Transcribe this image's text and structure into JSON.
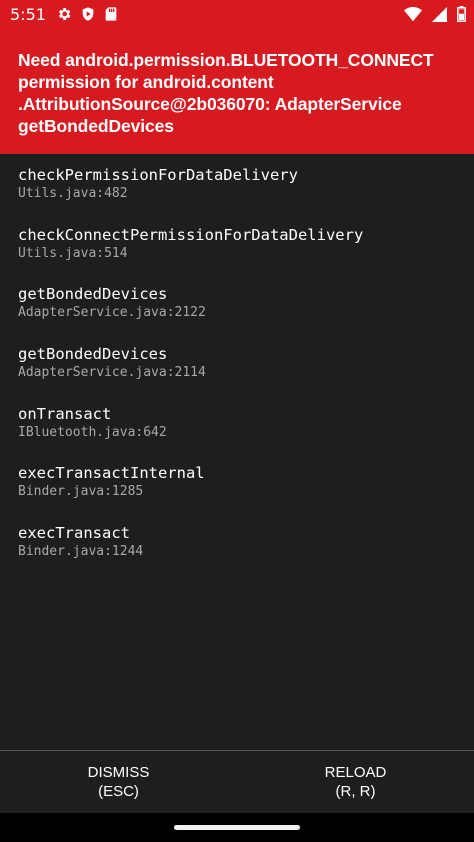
{
  "status_bar": {
    "time": "5:51",
    "left_icons": [
      "gear-icon",
      "play-protect-icon",
      "sd-card-icon"
    ],
    "right_icons": [
      "wifi-icon",
      "cellular-signal-icon",
      "battery-icon"
    ]
  },
  "error": {
    "title": "Need android.permission.BLUETOOTH_CONNECT permission for android.content .AttributionSource@2b036070: AdapterService getBondedDevices"
  },
  "stack_frames": [
    {
      "method": "checkPermissionForDataDelivery",
      "location": "Utils.java:482"
    },
    {
      "method": "checkConnectPermissionForDataDelivery",
      "location": "Utils.java:514"
    },
    {
      "method": "getBondedDevices",
      "location": "AdapterService.java:2122"
    },
    {
      "method": "getBondedDevices",
      "location": "AdapterService.java:2114"
    },
    {
      "method": "onTransact",
      "location": "IBluetooth.java:642"
    },
    {
      "method": "execTransactInternal",
      "location": "Binder.java:1285"
    },
    {
      "method": "execTransact",
      "location": "Binder.java:1244"
    }
  ],
  "footer": {
    "dismiss_label": "DISMISS",
    "dismiss_shortcut": "(ESC)",
    "reload_label": "RELOAD",
    "reload_shortcut": "(R, R)"
  },
  "colors": {
    "header_red": "#d71920",
    "list_background": "#1e1e1e",
    "location_text": "#a8a8a8"
  }
}
